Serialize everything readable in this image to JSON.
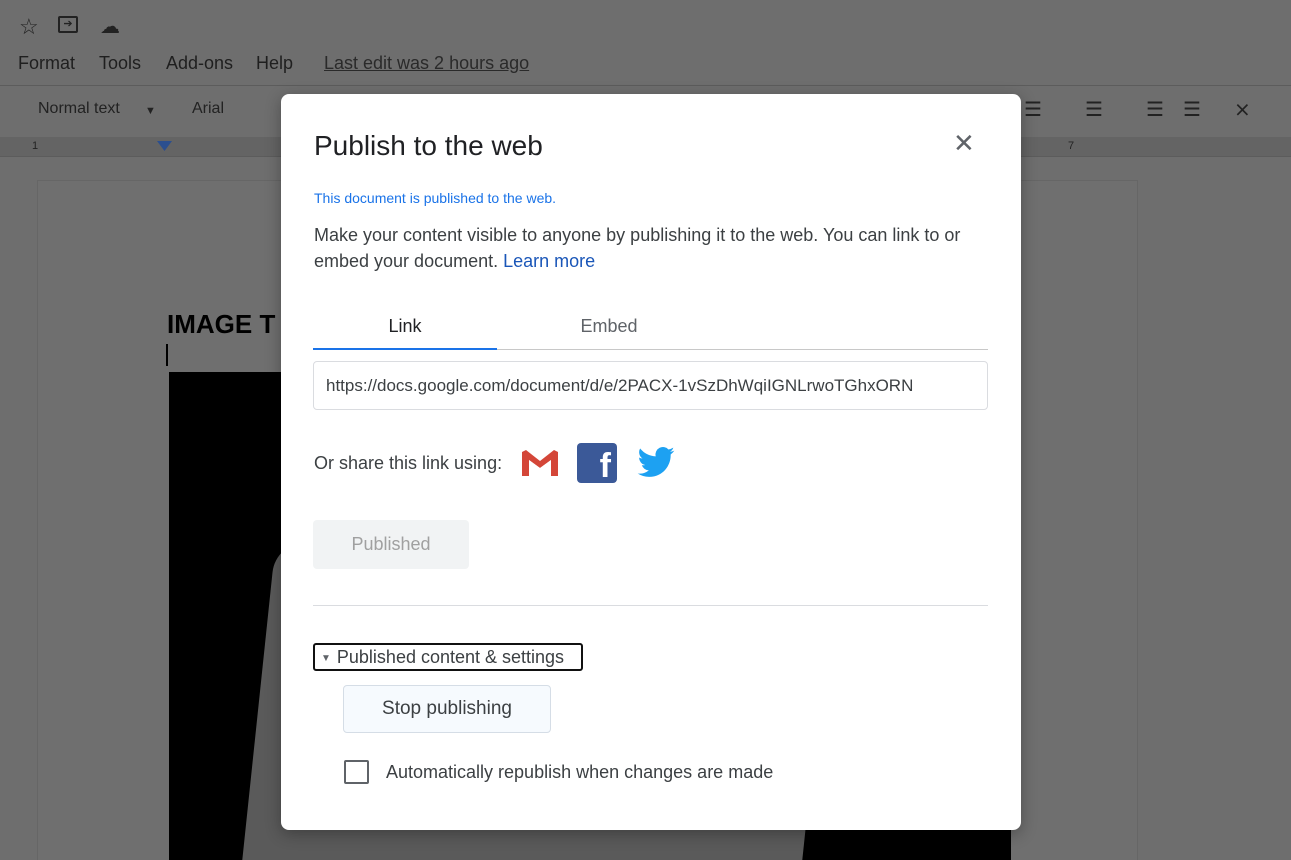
{
  "header": {
    "icons": [
      "star-icon",
      "move-to-folder-icon",
      "cloud-saved-icon"
    ],
    "menu": [
      "Format",
      "Tools",
      "Add-ons",
      "Help"
    ],
    "last_edit": "Last edit was 2 hours ago"
  },
  "toolbar": {
    "style": "Normal text",
    "font": "Arial",
    "ruler_marks": [
      "1",
      "7"
    ]
  },
  "document": {
    "heading": "IMAGE T"
  },
  "dialog": {
    "title": "Publish to the web",
    "status": "This document is published to the web.",
    "description": "Make your content visible to anyone by publishing it to the web. You can link to or embed your document.",
    "learn_more": "Learn more",
    "tabs": [
      {
        "label": "Link",
        "active": true
      },
      {
        "label": "Embed",
        "active": false
      }
    ],
    "url": "https://docs.google.com/document/d/e/2PACX-1vSzDhWqiIGNLrwoTGhxORN",
    "share_label": "Or share this link using:",
    "share_icons": [
      "gmail-icon",
      "facebook-icon",
      "twitter-icon"
    ],
    "published_button": "Published",
    "settings_toggle": "Published content & settings",
    "stop_button": "Stop publishing",
    "auto_republish_label": "Automatically republish when changes are made",
    "auto_republish_checked": false,
    "accent": "#1a73e8"
  }
}
